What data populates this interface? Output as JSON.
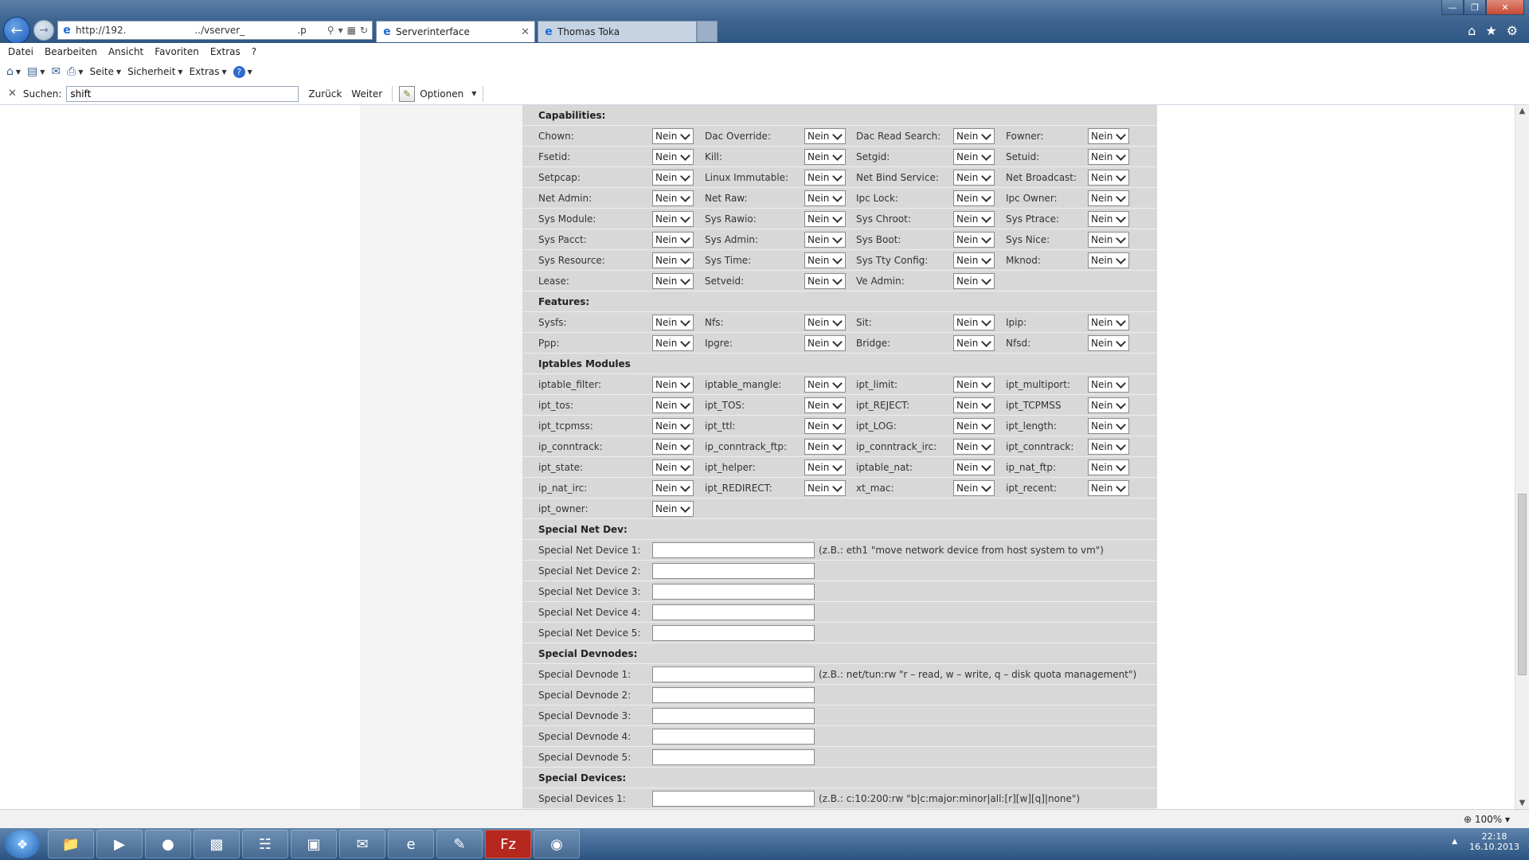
{
  "browser": {
    "url_start": "http://192.",
    "url_end": "../vserver_",
    "url_tail": ".p",
    "tabs": [
      {
        "label": "Serverinterface"
      },
      {
        "label": "Thomas Toka"
      }
    ],
    "menu": [
      "Datei",
      "Bearbeiten",
      "Ansicht",
      "Favoriten",
      "Extras",
      "?"
    ],
    "cmd": {
      "seite": "Seite",
      "sicherheit": "Sicherheit",
      "extras": "Extras"
    },
    "find": {
      "label": "Suchen:",
      "value": "shift",
      "prev": "Zurück",
      "next": "Weiter",
      "options": "Optionen"
    },
    "zoom": "100%"
  },
  "form": {
    "capabilities_title": "Capabilities:",
    "features_title": "Features:",
    "iptables_title": "Iptables Modules",
    "net_dev_title": "Special Net Dev:",
    "devnodes_title": "Special Devnodes:",
    "devices_title": "Special Devices:",
    "select_value": "Nein",
    "caps": [
      [
        "Chown:",
        "Dac Override:",
        "Dac Read Search:",
        "Fowner:"
      ],
      [
        "Fsetid:",
        "Kill:",
        "Setgid:",
        "Setuid:"
      ],
      [
        "Setpcap:",
        "Linux Immutable:",
        "Net Bind Service:",
        "Net Broadcast:"
      ],
      [
        "Net Admin:",
        "Net Raw:",
        "Ipc Lock:",
        "Ipc Owner:"
      ],
      [
        "Sys Module:",
        "Sys Rawio:",
        "Sys Chroot:",
        "Sys Ptrace:"
      ],
      [
        "Sys Pacct:",
        "Sys Admin:",
        "Sys Boot:",
        "Sys Nice:"
      ],
      [
        "Sys Resource:",
        "Sys Time:",
        "Sys Tty Config:",
        "Mknod:"
      ],
      [
        "Lease:",
        "Setveid:",
        "Ve Admin:"
      ]
    ],
    "features": [
      [
        "Sysfs:",
        "Nfs:",
        "Sit:",
        "Ipip:"
      ],
      [
        "Ppp:",
        "Ipgre:",
        "Bridge:",
        "Nfsd:"
      ]
    ],
    "iptables": [
      [
        "iptable_filter:",
        "iptable_mangle:",
        "ipt_limit:",
        "ipt_multiport:"
      ],
      [
        "ipt_tos:",
        "ipt_TOS:",
        "ipt_REJECT:",
        "ipt_TCPMSS"
      ],
      [
        "ipt_tcpmss:",
        "ipt_ttl:",
        "ipt_LOG:",
        "ipt_length:"
      ],
      [
        "ip_conntrack:",
        "ip_conntrack_ftp:",
        "ip_conntrack_irc:",
        "ipt_conntrack:"
      ],
      [
        "ipt_state:",
        "ipt_helper:",
        "iptable_nat:",
        "ip_nat_ftp:"
      ],
      [
        "ip_nat_irc:",
        "ipt_REDIRECT:",
        "xt_mac:",
        "ipt_recent:"
      ],
      [
        "ipt_owner:"
      ]
    ],
    "net_devs": [
      {
        "label": "Special Net Device 1:",
        "hint": "(z.B.: eth1 \"move network device from host system to vm\")"
      },
      {
        "label": "Special Net Device 2:",
        "hint": ""
      },
      {
        "label": "Special Net Device 3:",
        "hint": ""
      },
      {
        "label": "Special Net Device 4:",
        "hint": ""
      },
      {
        "label": "Special Net Device 5:",
        "hint": ""
      }
    ],
    "devnodes": [
      {
        "label": "Special Devnode 1:",
        "hint": "(z.B.: net/tun:rw \"r – read, w – write, q – disk quota management\")"
      },
      {
        "label": "Special Devnode 2:",
        "hint": ""
      },
      {
        "label": "Special Devnode 3:",
        "hint": ""
      },
      {
        "label": "Special Devnode 4:",
        "hint": ""
      },
      {
        "label": "Special Devnode 5:",
        "hint": ""
      }
    ],
    "devices": [
      {
        "label": "Special Devices 1:",
        "hint": "(z.B.: c:10:200:rw \"b|c:major:minor|all:[r][w][q]|none\")"
      }
    ]
  },
  "taskbar": {
    "time": "22:18",
    "date": "16.10.2013"
  },
  "icons": {
    "back": "back-arrow-icon",
    "forward": "forward-arrow-icon",
    "home": "home-icon",
    "favorites": "star-icon",
    "tools": "gear-icon",
    "refresh": "refresh-icon",
    "search": "search-icon"
  }
}
